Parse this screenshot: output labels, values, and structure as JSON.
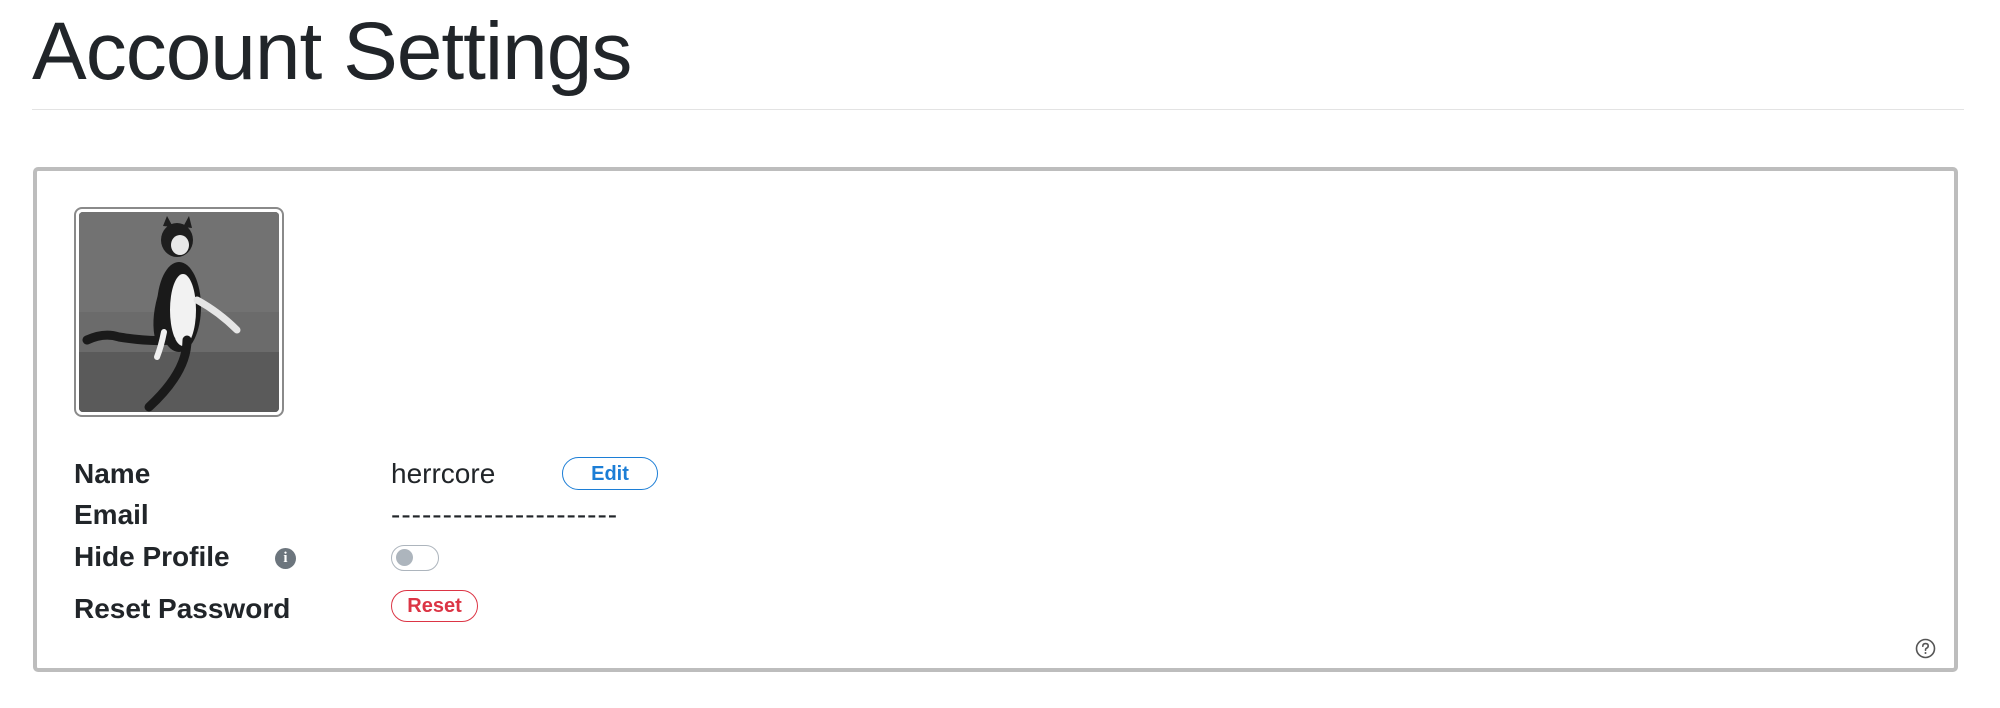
{
  "page": {
    "title": "Account Settings"
  },
  "profile": {
    "avatar_icon": "profile-photo-dog",
    "name_label": "Name",
    "name_value": "herrcore",
    "edit_label": "Edit",
    "email_label": "Email",
    "email_value": "----------------------",
    "hide_profile_label": "Hide Profile",
    "hide_profile_info_icon": "info-icon",
    "hide_profile_enabled": false,
    "reset_password_label": "Reset Password",
    "reset_label": "Reset",
    "help_icon": "question-circle-icon"
  },
  "colors": {
    "edit_accent": "#1c7ed6",
    "reset_accent": "#dc3545",
    "toggle_off": "#adb5bd",
    "card_border": "#bdbdbd"
  }
}
